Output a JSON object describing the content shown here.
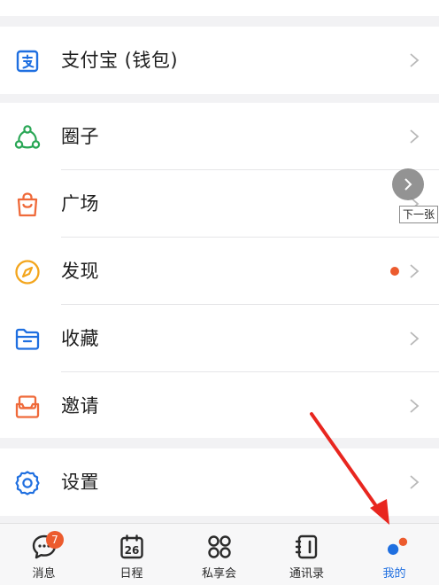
{
  "menu": {
    "alipay": {
      "label": "支付宝 (钱包)"
    },
    "circle": {
      "label": "圈子"
    },
    "square": {
      "label": "广场"
    },
    "discover": {
      "label": "发现"
    },
    "favorites": {
      "label": "收藏"
    },
    "invite": {
      "label": "邀请"
    },
    "settings": {
      "label": "设置"
    }
  },
  "overlay": {
    "next_label": "下一张"
  },
  "tabbar": {
    "messages": {
      "label": "消息",
      "badge": "7"
    },
    "calendar": {
      "label": "日程",
      "date": "26"
    },
    "club": {
      "label": "私享会"
    },
    "contacts": {
      "label": "通讯录"
    },
    "me": {
      "label": "我的"
    }
  },
  "colors": {
    "accent_blue": "#1f6fe0",
    "badge_orange": "#ec5b2e",
    "circle_green": "#2aa756",
    "square_orange": "#ef6a3a",
    "discover_yellow": "#f3a51c",
    "annotation_red": "#e8261f"
  },
  "icons": {
    "alipay": "alipay-icon",
    "circle": "circle-network-icon",
    "square": "shopping-bag-icon",
    "discover": "compass-icon",
    "favorites": "folder-icon",
    "invite": "invite-icon",
    "settings": "gear-icon"
  }
}
